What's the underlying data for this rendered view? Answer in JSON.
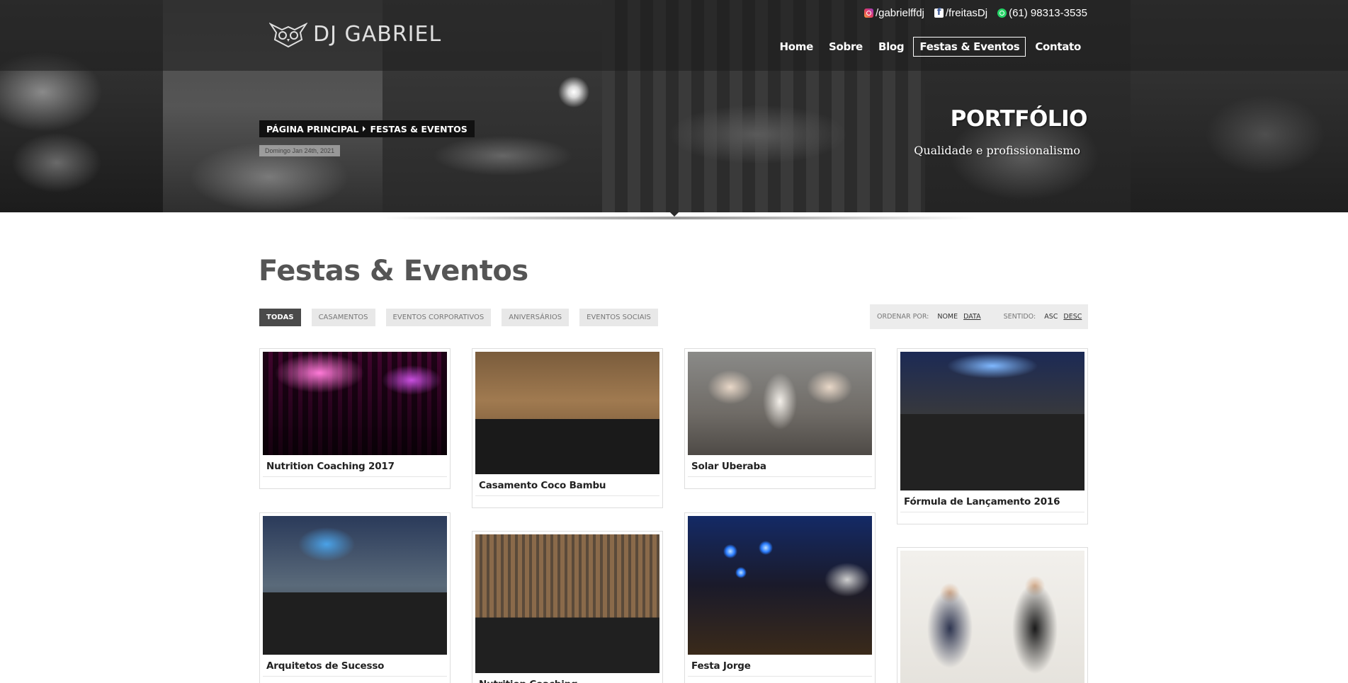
{
  "header": {
    "logo_text": "DJ GABRIEL",
    "social": [
      {
        "icon": "instagram-icon",
        "label": "/gabrielffdj"
      },
      {
        "icon": "facebook-icon",
        "label": "/freitasDj"
      },
      {
        "icon": "whatsapp-icon",
        "label": "(61) 98313-3535"
      }
    ],
    "nav": [
      {
        "label": "Home"
      },
      {
        "label": "Sobre"
      },
      {
        "label": "Blog"
      },
      {
        "label": "Festas & Eventos"
      },
      {
        "label": "Contato"
      }
    ]
  },
  "hero": {
    "breadcrumb_home": "PÁGINA PRINCIPAL",
    "breadcrumb_current": "FESTAS & EVENTOS",
    "date": "Domingo Jan 24th, 2021",
    "title": "PORTFÓLIO",
    "subtitle": "Qualidade e profissionalismo"
  },
  "main": {
    "title": "Festas & Eventos",
    "filters": [
      "TODAS",
      "CASAMENTOS",
      "EVENTOS CORPORATIVOS",
      "ANIVERSÁRIOS",
      "EVENTOS SOCIAIS"
    ],
    "sort": {
      "order_label": "ORDENAR POR:",
      "order_name": "NOME",
      "order_date": "DATA",
      "direction_label": "SENTIDO:",
      "asc": "ASC",
      "desc": "DESC"
    },
    "portfolio": [
      {
        "title": "Nutrition Coaching 2017"
      },
      {
        "title": "Casamento Coco Bambu"
      },
      {
        "title": "Solar Uberaba"
      },
      {
        "title": "Fórmula de Lançamento 2016"
      },
      {
        "title": "Arquitetos de Sucesso"
      },
      {
        "title": "Nutrition Coaching"
      },
      {
        "title": "Festa Jorge"
      },
      {
        "title": ""
      }
    ]
  },
  "colors": {
    "accent_dark": "#4a4a4a",
    "filter_bg": "#e8e8e8",
    "title_gray": "#555555"
  }
}
